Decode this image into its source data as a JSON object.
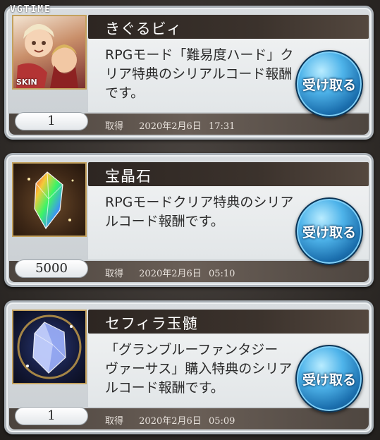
{
  "watermark": "VGTIME",
  "rewards": [
    {
      "title": "きぐるビィ",
      "description": "RPGモード「難易度ハード」クリア特典のシリアルコード報酬です。",
      "quantity": "1",
      "obtained_label": "取得",
      "obtained_date": "2020年2月6日",
      "obtained_time": "17:31",
      "button_label": "受け取る",
      "thumbnail_badge": "SKIN",
      "thumbnail_icon": "character-skin-icon"
    },
    {
      "title": "宝晶石",
      "description": "RPGモードクリア特典のシリアルコード報酬です。",
      "quantity": "5000",
      "obtained_label": "取得",
      "obtained_date": "2020年2月6日",
      "obtained_time": "05:10",
      "button_label": "受け取る",
      "thumbnail_icon": "rainbow-crystal-icon"
    },
    {
      "title": "セフィラ玉髄",
      "description": "「グランブルーファンタジー ヴァーサス」購入特典のシリアルコード報酬です。",
      "quantity": "1",
      "obtained_label": "取得",
      "obtained_date": "2020年2月6日",
      "obtained_time": "05:09",
      "button_label": "受け取る",
      "thumbnail_icon": "sephira-crystal-icon"
    }
  ]
}
